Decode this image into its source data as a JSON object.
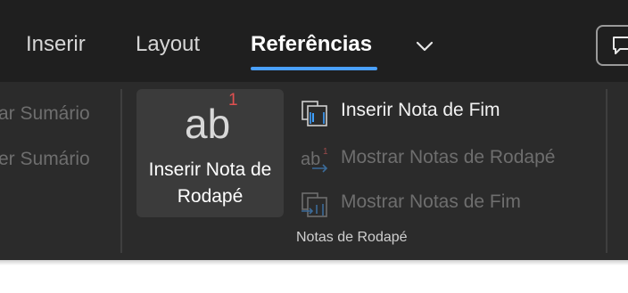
{
  "tabs": [
    {
      "label": "Inserir",
      "active": false
    },
    {
      "label": "Layout",
      "active": false
    },
    {
      "label": "Referências",
      "active": true
    }
  ],
  "accent_color": "#4aa0ff",
  "left_group": {
    "items": [
      "ar Sumário",
      "er Sumário"
    ]
  },
  "footnotes_group": {
    "big_button": {
      "icon_text": "ab",
      "superscript": "1",
      "label_line1": "Inserir Nota de",
      "label_line2": "Rodapé"
    },
    "items": [
      {
        "label": "Inserir Nota de Fim",
        "enabled": true,
        "icon": "insert-endnote-icon"
      },
      {
        "label": "Mostrar Notas de Rodapé",
        "enabled": false,
        "icon": "show-footnotes-icon"
      },
      {
        "label": "Mostrar Notas de Fim",
        "enabled": false,
        "icon": "show-endnotes-icon"
      }
    ],
    "group_label": "Notas de Rodapé"
  },
  "icons": [
    "chevron-down-icon",
    "comment-icon"
  ]
}
